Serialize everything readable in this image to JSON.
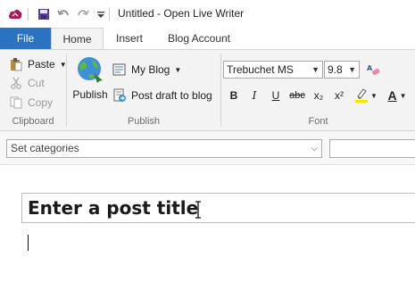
{
  "window": {
    "title": "Untitled - Open Live Writer"
  },
  "quick_access": {
    "icons": [
      "live-writer-logo-icon",
      "save-icon",
      "undo-icon",
      "redo-icon",
      "customize-dropdown-icon"
    ]
  },
  "tabs": [
    {
      "label": "File"
    },
    {
      "label": "Home"
    },
    {
      "label": "Insert"
    },
    {
      "label": "Blog Account"
    }
  ],
  "ribbon": {
    "clipboard": {
      "group_label": "Clipboard",
      "paste_label": "Paste",
      "cut_label": "Cut",
      "copy_label": "Copy"
    },
    "publish": {
      "group_label": "Publish",
      "publish_label": "Publish",
      "my_blog_label": "My Blog",
      "post_draft_label": "Post draft to blog"
    },
    "font": {
      "group_label": "Font",
      "font_family": "Trebuchet MS",
      "font_size": "9.8",
      "bold": "B",
      "italic": "I",
      "underline": "U",
      "strike": "abc",
      "subscript": "x₂",
      "superscript": "x²",
      "font_color": "A",
      "highlight_color": "#f5e800",
      "font_color_bar": "#1a1a1a"
    }
  },
  "categories": {
    "placeholder": "Set categories"
  },
  "editor": {
    "title_placeholder": "Enter a post title"
  },
  "colors": {
    "file_tab": "#2b73c2",
    "ribbon_bg": "#f3f3f3"
  }
}
